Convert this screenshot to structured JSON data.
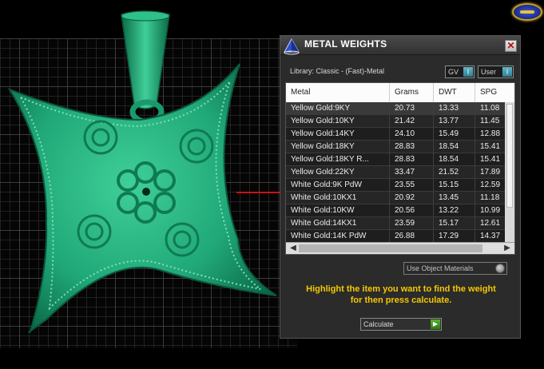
{
  "panel": {
    "title": "METAL WEIGHTS",
    "close_label": "✕",
    "library_label": "Library: Classic - (Fast)-Metal",
    "toggle_gv": "GV",
    "toggle_user": "User",
    "toggle_knob": "I"
  },
  "table": {
    "headers": [
      "Metal",
      "Grams",
      "DWT",
      "SPG"
    ],
    "rows": [
      [
        "Yellow Gold:9KY",
        "20.73",
        "13.33",
        "11.08"
      ],
      [
        "Yellow Gold:10KY",
        "21.42",
        "13.77",
        "11.45"
      ],
      [
        "Yellow Gold:14KY",
        "24.10",
        "15.49",
        "12.88"
      ],
      [
        "Yellow Gold:18KY",
        "28.83",
        "18.54",
        "15.41"
      ],
      [
        "Yellow Gold:18KY R...",
        "28.83",
        "18.54",
        "15.41"
      ],
      [
        "Yellow Gold:22KY",
        "33.47",
        "21.52",
        "17.89"
      ],
      [
        "White Gold:9K PdW",
        "23.55",
        "15.15",
        "12.59"
      ],
      [
        "White Gold:10KX1",
        "20.92",
        "13.45",
        "11.18"
      ],
      [
        "White Gold:10KW",
        "20.56",
        "13.22",
        "10.99"
      ],
      [
        "White Gold:14KX1",
        "23.59",
        "15.17",
        "12.61"
      ],
      [
        "White Gold:14K PdW",
        "26.88",
        "17.29",
        "14.37"
      ]
    ],
    "scroll_left": "◀",
    "scroll_right": "▶"
  },
  "controls": {
    "use_object_materials": "Use Object Materials",
    "instruction_line1": "Highlight the item you want to find the weight",
    "instruction_line2": "for then press calculate.",
    "calculate_label": "Calculate",
    "calculate_arrow": "▶"
  },
  "colors": {
    "model_green": "#1fa579",
    "instruction_yellow": "#f5c800",
    "axis_red": "#d01010"
  },
  "icons": [
    "pyramid-icon",
    "close-icon",
    "logo-icon",
    "play-icon"
  ]
}
